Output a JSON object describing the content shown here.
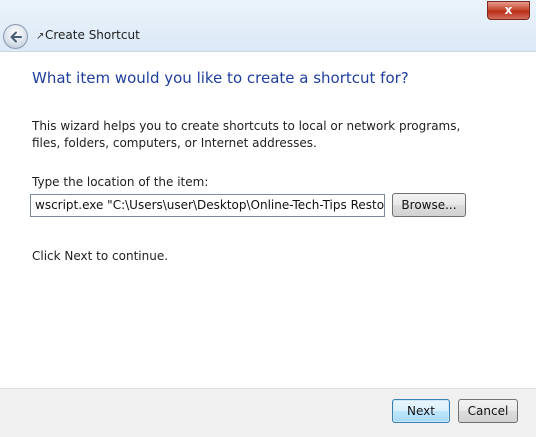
{
  "window": {
    "title": "Create Shortcut",
    "close_symbol": "x",
    "back_icon": "back-arrow-icon"
  },
  "content": {
    "heading": "What item would you like to create a shortcut for?",
    "description": "This wizard helps you to create shortcuts to local or network programs, files, folders, computers, or Internet addresses.",
    "location_label": "Type the location of the item:",
    "location_value": "wscript.exe \"C:\\Users\\user\\Desktop\\Online-Tech-Tips Restore Script.v",
    "browse_label": "Browse...",
    "continue_text": "Click Next to continue."
  },
  "footer": {
    "next_label": "Next",
    "cancel_label": "Cancel"
  },
  "colors": {
    "heading": "#1f3f9c",
    "close_button": "#c74a33",
    "footer_bg": "#f0f0f0"
  }
}
